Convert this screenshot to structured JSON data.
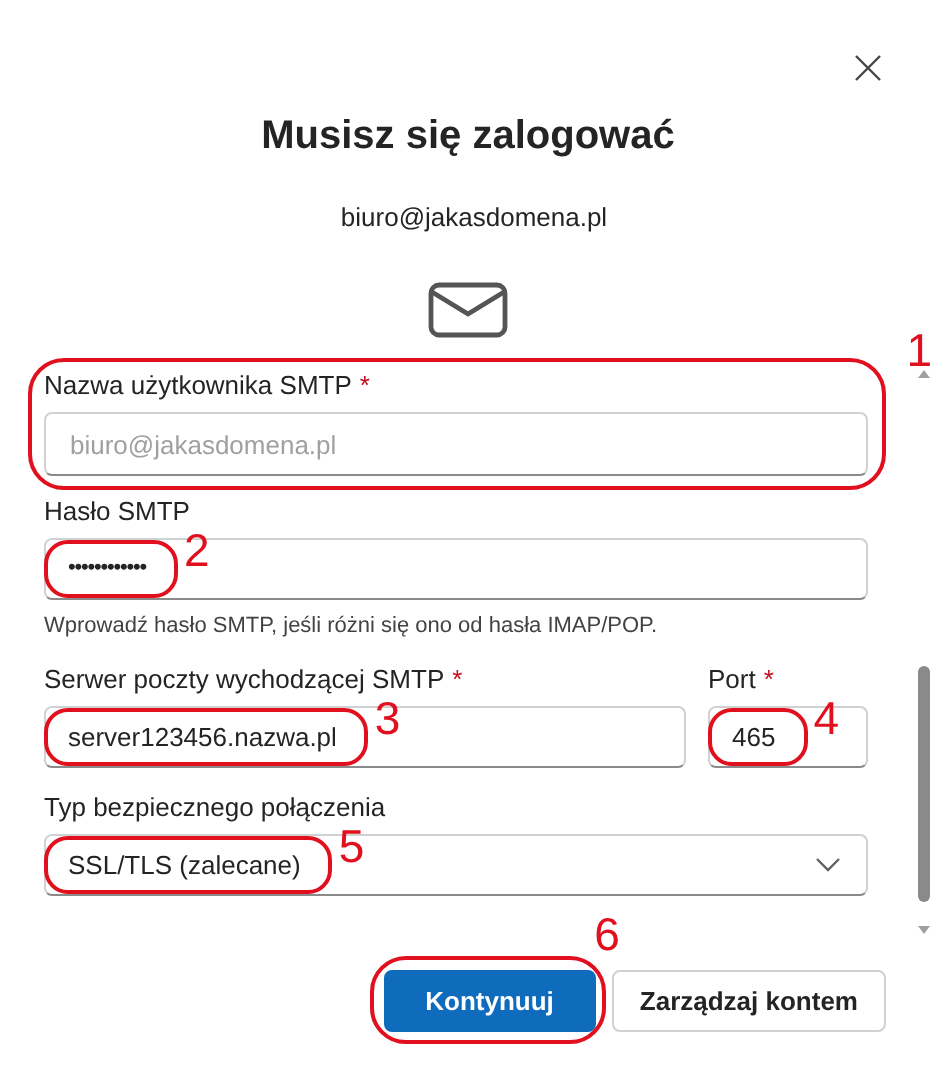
{
  "dialog": {
    "title": "Musisz się zalogować",
    "account": "biuro@jakasdomena.pl"
  },
  "fields": [
    {
      "kind": "text",
      "label": "Nazwa użytkownika SMTP",
      "required_mark": "*",
      "placeholder": "biuro@jakasdomena.pl",
      "annotation": "1"
    },
    {
      "kind": "password",
      "label": "Hasło SMTP",
      "value": "••••••••••••",
      "value_annotation": "2",
      "hint": "Wprowadź hasło SMTP, jeśli różni się ono od hasła IMAP/POP."
    },
    {
      "kind": "row",
      "fields": [
        {
          "kind": "text",
          "label": "Serwer poczty wychodzącej SMTP",
          "required_mark": "*",
          "value": "server123456.nazwa.pl",
          "value_annotation": "3"
        },
        {
          "kind": "text",
          "label": "Port",
          "required_mark": "*",
          "value": "465",
          "value_annotation": "4"
        }
      ]
    },
    {
      "kind": "select",
      "label": "Typ bezpiecznego połączenia",
      "value": "SSL/TLS (zalecane)",
      "value_annotation": "5"
    }
  ],
  "buttons": [
    {
      "label": "Kontynuuj",
      "primary": true,
      "annotation": "6"
    },
    {
      "label": "Zarządzaj kontem",
      "primary": false
    }
  ]
}
